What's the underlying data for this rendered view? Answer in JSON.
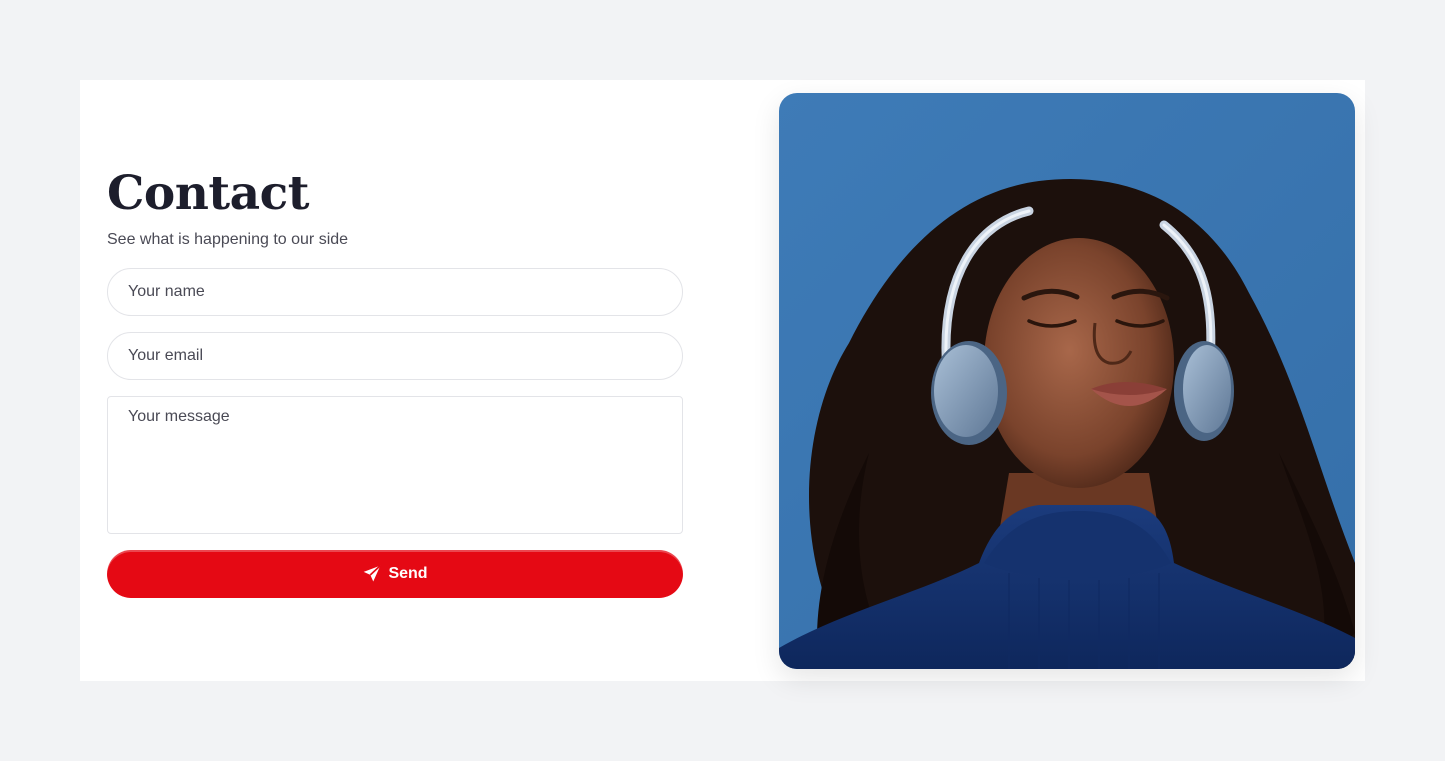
{
  "contact": {
    "title": "Contact",
    "subtitle": "See what is happening to our side"
  },
  "form": {
    "name_placeholder": "Your name",
    "email_placeholder": "Your email",
    "message_placeholder": "Your message",
    "send_label": "Send",
    "send_icon": "paper-plane-icon"
  },
  "colors": {
    "page_background": "#f2f3f5",
    "card_background": "#ffffff",
    "title_text": "#1d1e2c",
    "accent_button": "#e50914",
    "photo_sky": "#3d7bb6",
    "photo_sweater": "#12306b"
  },
  "image": {
    "subject": "woman-with-headphones-photo"
  }
}
